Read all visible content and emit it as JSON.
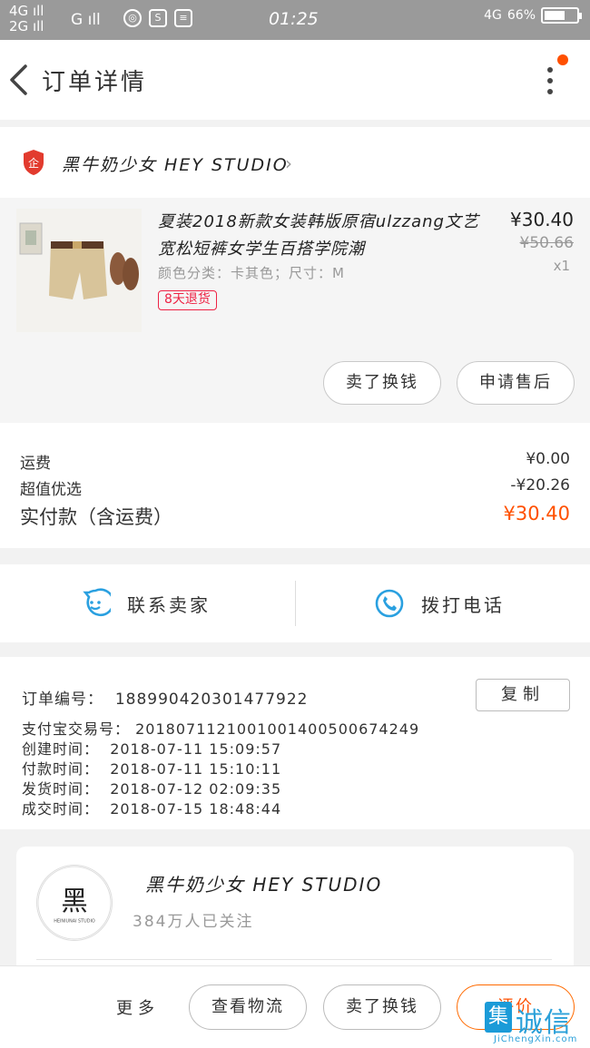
{
  "status_bar": {
    "net_left_1": "4G",
    "net_left_2": "2G",
    "net_g": "G",
    "time": "01:25",
    "net_right": "4G",
    "battery_text": "66%",
    "battery_level": 0.66
  },
  "nav": {
    "title": "订单详情"
  },
  "shop": {
    "name": "黑牛奶少女 HEY STUDIO",
    "logo_text": "企"
  },
  "product": {
    "title": "夏装2018新款女装韩版原宿ulzzang文艺宽松短裤女学生百搭学院潮",
    "sku": "颜色分类：卡其色；尺寸：M",
    "badge": "8天退货",
    "price": "¥30.40",
    "original_price": "¥50.66",
    "quantity": "x1",
    "btn_sell": "卖了换钱",
    "btn_after_sales": "申请售后"
  },
  "fees": {
    "shipping_label": "运费",
    "shipping_value": "¥0.00",
    "discount_label": "超值优选",
    "discount_value": "-¥20.26",
    "total_label": "实付款（含运费）",
    "total_value": "¥30.40"
  },
  "contact": {
    "seller": "联系卖家",
    "call": "拨打电话"
  },
  "order_info": {
    "order_no_label": "订单编号：",
    "order_no": "188990420301477922",
    "copy_label": "复制",
    "alipay_label": "支付宝交易号：",
    "alipay_no": "2018071121001001400500674249",
    "created_label": "创建时间：",
    "created": "2018-07-11  15:09:57",
    "paid_label": "付款时间：",
    "paid": "2018-07-11  15:10:11",
    "shipped_label": "发货时间：",
    "shipped": "2018-07-12  02:09:35",
    "completed_label": "成交时间：",
    "completed": "2018-07-15  18:48:44"
  },
  "shop_card": {
    "name": "黑牛奶少女 HEY STUDIO",
    "followers": "384万人已关注",
    "avatar_char": "黑",
    "avatar_sub": "HEINIUNAI STUDIO"
  },
  "bottom_bar": {
    "more": "更多",
    "logistics": "查看物流",
    "sell": "卖了换钱",
    "review": "评价"
  },
  "watermark": {
    "badge": "集",
    "text": "诚信",
    "sub": "JiChengXin.com"
  },
  "colors": {
    "accent": "#ff5000",
    "status_bar": "#9a9a9a",
    "icon_blue": "#2aa0e0"
  }
}
